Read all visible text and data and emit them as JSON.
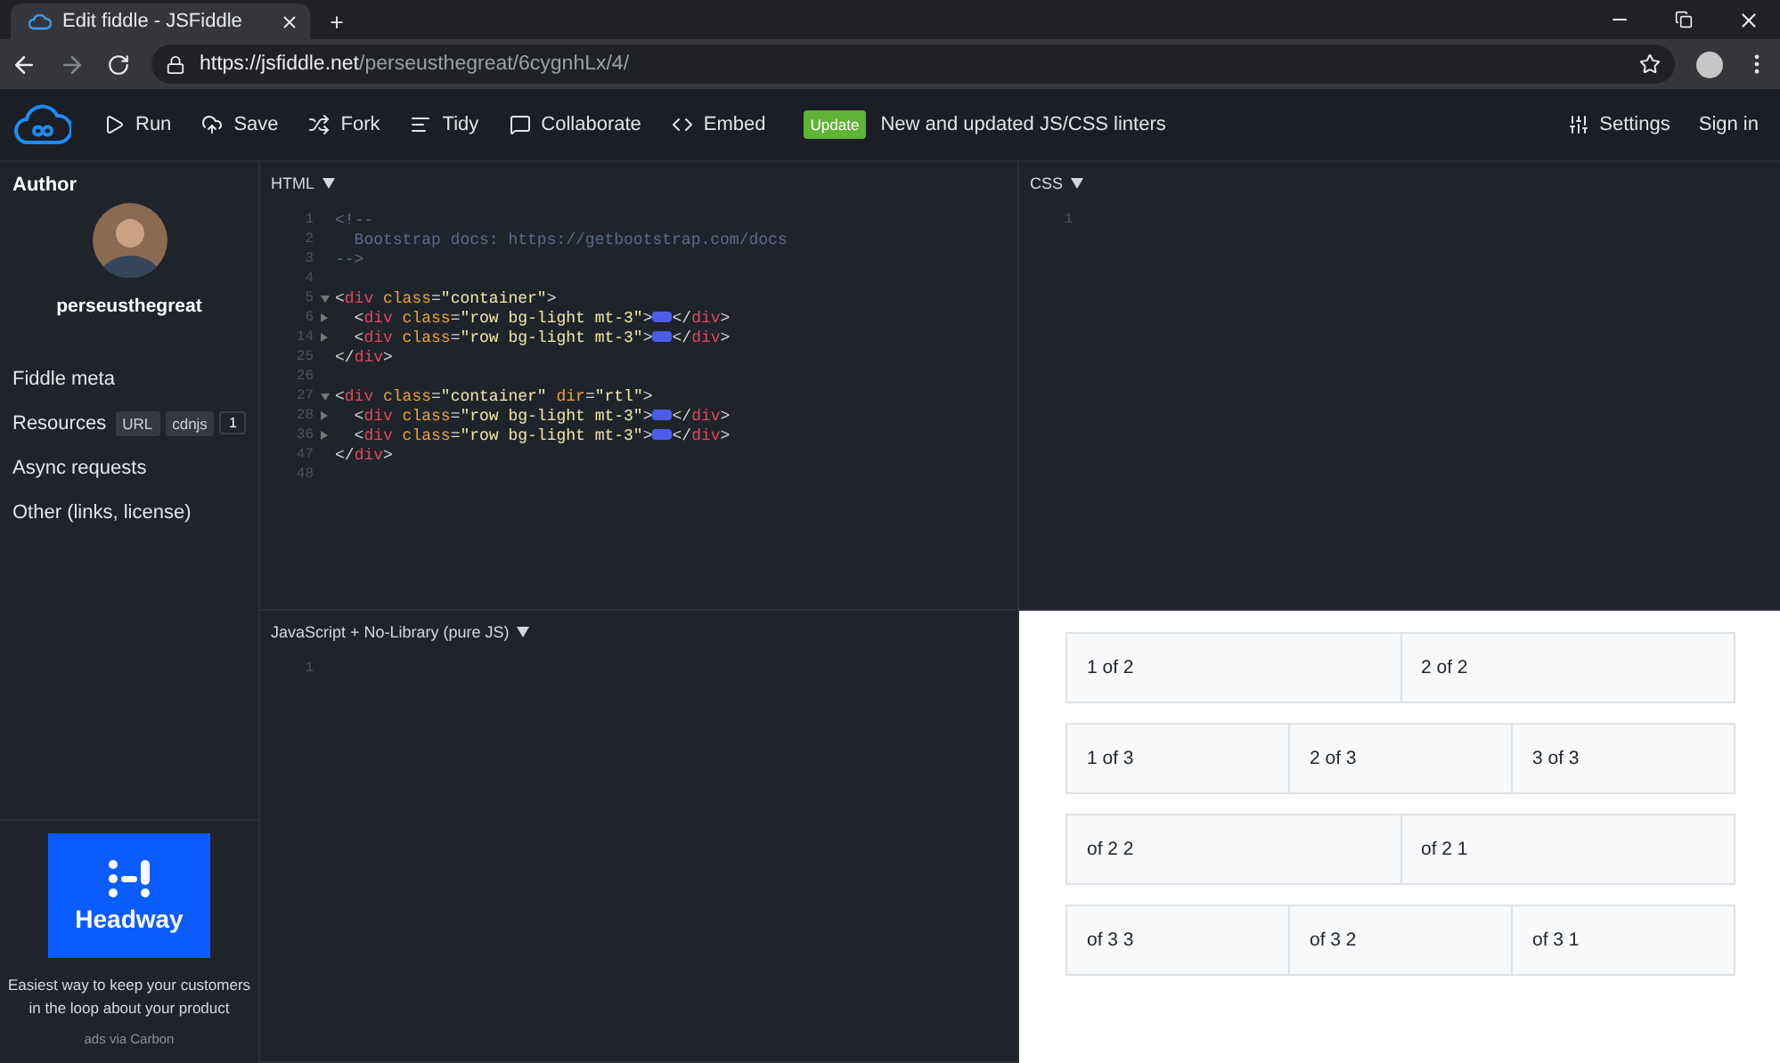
{
  "browser": {
    "tab_title": "Edit fiddle - JSFiddle",
    "new_tab": "+",
    "url_host": "https://jsfiddle.net",
    "url_path": "/perseusthegreat/6cygnhLx/4/"
  },
  "toolbar": {
    "actions": [
      {
        "label": "Run"
      },
      {
        "label": "Save"
      },
      {
        "label": "Fork"
      },
      {
        "label": "Tidy"
      },
      {
        "label": "Collaborate"
      },
      {
        "label": "Embed"
      }
    ],
    "update_badge": "Update",
    "update_text": "New and updated JS/CSS linters",
    "settings": "Settings",
    "sign_in": "Sign in"
  },
  "sidebar": {
    "author_heading": "Author",
    "username": "perseusthegreat",
    "items": [
      {
        "label": "Fiddle meta"
      },
      {
        "label": "Resources",
        "tags": [
          "URL",
          "cdnjs"
        ],
        "count": "1"
      },
      {
        "label": "Async requests"
      },
      {
        "label": "Other (links, license)"
      }
    ],
    "ad": {
      "brand": "Headway",
      "text": "Easiest way to keep your customers in the loop about your product",
      "credit": "ads via Carbon"
    }
  },
  "html_panel": {
    "label": "HTML",
    "lines": [
      {
        "num": "1",
        "tokens": [
          {
            "kind": "comment",
            "text": "<!--"
          }
        ]
      },
      {
        "num": "2",
        "tokens": [
          {
            "kind": "comment",
            "text": "  Bootstrap docs: https://getbootstrap.com/docs"
          }
        ]
      },
      {
        "num": "3",
        "tokens": [
          {
            "kind": "comment",
            "text": "-->"
          }
        ]
      },
      {
        "num": "4"
      },
      {
        "num": "5",
        "folded": false,
        "tokens": [
          {
            "kind": "punct",
            "text": "<"
          },
          {
            "kind": "tag",
            "text": "div"
          },
          {
            "kind": "attr",
            "text": " class"
          },
          {
            "kind": "punct",
            "text": "="
          },
          {
            "kind": "string",
            "text": "\"container\""
          },
          {
            "kind": "punct",
            "text": ">"
          }
        ]
      },
      {
        "num": "6",
        "folded": true,
        "tokens": [
          {
            "kind": "punct",
            "text": "  <"
          },
          {
            "kind": "tag",
            "text": "div"
          },
          {
            "kind": "attr",
            "text": " class"
          },
          {
            "kind": "punct",
            "text": "="
          },
          {
            "kind": "string",
            "text": "\"row bg-light mt-3\""
          },
          {
            "kind": "punct",
            "text": ">"
          },
          {
            "kind": "marker"
          },
          {
            "kind": "punct",
            "text": "</"
          },
          {
            "kind": "tag",
            "text": "div"
          },
          {
            "kind": "punct",
            "text": ">"
          }
        ]
      },
      {
        "num": "14",
        "folded": true,
        "tokens": [
          {
            "kind": "punct",
            "text": "  <"
          },
          {
            "kind": "tag",
            "text": "div"
          },
          {
            "kind": "attr",
            "text": " class"
          },
          {
            "kind": "punct",
            "text": "="
          },
          {
            "kind": "string",
            "text": "\"row bg-light mt-3\""
          },
          {
            "kind": "punct",
            "text": ">"
          },
          {
            "kind": "marker"
          },
          {
            "kind": "punct",
            "text": "</"
          },
          {
            "kind": "tag",
            "text": "div"
          },
          {
            "kind": "punct",
            "text": ">"
          }
        ]
      },
      {
        "num": "25",
        "tokens": [
          {
            "kind": "punct",
            "text": "</"
          },
          {
            "kind": "tag",
            "text": "div"
          },
          {
            "kind": "punct",
            "text": ">"
          }
        ]
      },
      {
        "num": "26"
      },
      {
        "num": "27",
        "folded": false,
        "tokens": [
          {
            "kind": "punct",
            "text": "<"
          },
          {
            "kind": "tag",
            "text": "div"
          },
          {
            "kind": "attr",
            "text": " class"
          },
          {
            "kind": "punct",
            "text": "="
          },
          {
            "kind": "string",
            "text": "\"container\""
          },
          {
            "kind": "attr",
            "text": " dir"
          },
          {
            "kind": "punct",
            "text": "="
          },
          {
            "kind": "string",
            "text": "\"rtl\""
          },
          {
            "kind": "punct",
            "text": ">"
          }
        ]
      },
      {
        "num": "28",
        "folded": true,
        "tokens": [
          {
            "kind": "punct",
            "text": "  <"
          },
          {
            "kind": "tag",
            "text": "div"
          },
          {
            "kind": "attr",
            "text": " class"
          },
          {
            "kind": "punct",
            "text": "="
          },
          {
            "kind": "string",
            "text": "\"row bg-light mt-3\""
          },
          {
            "kind": "punct",
            "text": ">"
          },
          {
            "kind": "marker"
          },
          {
            "kind": "punct",
            "text": "</"
          },
          {
            "kind": "tag",
            "text": "div"
          },
          {
            "kind": "punct",
            "text": ">"
          }
        ]
      },
      {
        "num": "36",
        "folded": true,
        "tokens": [
          {
            "kind": "punct",
            "text": "  <"
          },
          {
            "kind": "tag",
            "text": "div"
          },
          {
            "kind": "attr",
            "text": " class"
          },
          {
            "kind": "punct",
            "text": "="
          },
          {
            "kind": "string",
            "text": "\"row bg-light mt-3\""
          },
          {
            "kind": "punct",
            "text": ">"
          },
          {
            "kind": "marker"
          },
          {
            "kind": "punct",
            "text": "</"
          },
          {
            "kind": "tag",
            "text": "div"
          },
          {
            "kind": "punct",
            "text": ">"
          }
        ]
      },
      {
        "num": "47",
        "tokens": [
          {
            "kind": "punct",
            "text": "</"
          },
          {
            "kind": "tag",
            "text": "div"
          },
          {
            "kind": "punct",
            "text": ">"
          }
        ]
      },
      {
        "num": "48"
      }
    ]
  },
  "css_panel": {
    "label": "CSS",
    "lines": [
      {
        "num": "1"
      }
    ]
  },
  "js_panel": {
    "label": "JavaScript + No-Library (pure JS)",
    "lines": [
      {
        "num": "1"
      }
    ]
  },
  "result": {
    "rows": [
      [
        "1 of 2",
        "2 of 2"
      ],
      [
        "1 of 3",
        "2 of 3",
        "3 of 3"
      ],
      [
        "of 2 2",
        "of 2 1"
      ],
      [
        "of 3 3",
        "of 3 2",
        "of 3 1"
      ]
    ]
  }
}
